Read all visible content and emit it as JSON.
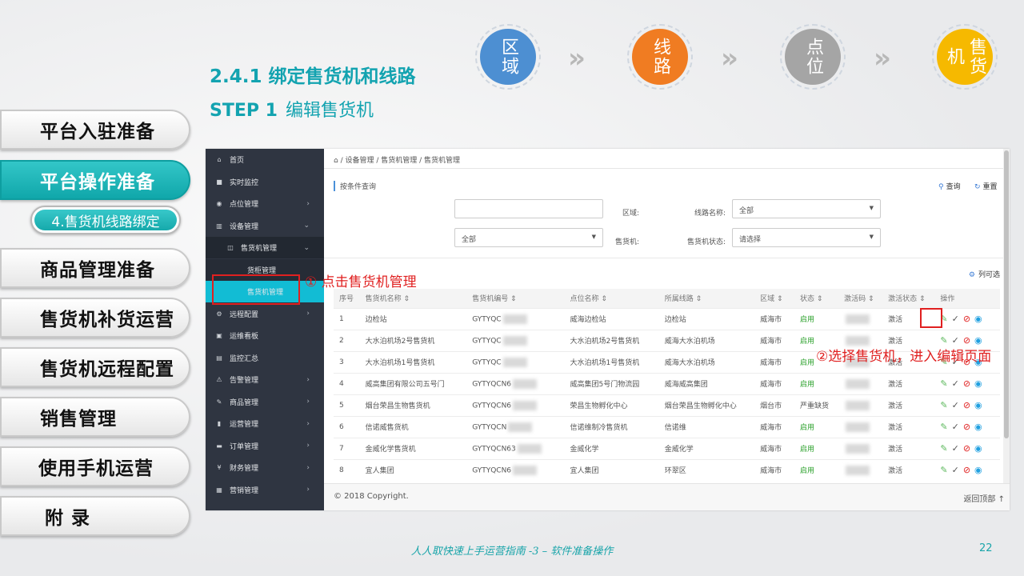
{
  "section_title": "2.4.1 绑定售货机和线路",
  "step_title": {
    "step": "STEP 1",
    "sub": "编辑售货机"
  },
  "steps": [
    {
      "label": "区域",
      "color": "#4d8fd2"
    },
    {
      "label": "线路",
      "color": "#f07c22"
    },
    {
      "label": "点位",
      "color": "#a5a5a5"
    },
    {
      "label": "售货机",
      "color": "#f6b900"
    }
  ],
  "chevron": "»",
  "left_nav": [
    "平台入驻准备",
    "平台操作准备",
    "商品管理准备",
    "售货机补货运营",
    "售货机远程配置",
    "销售管理",
    "使用手机运营",
    "附 录"
  ],
  "left_nav_active": "平台操作准备",
  "left_subtab": "4.售货机线路绑定",
  "app": {
    "sidebar": [
      {
        "icon": "home-icon",
        "glyph": "⌂",
        "label": "首页",
        "arrow": ""
      },
      {
        "icon": "camera-icon",
        "glyph": "■",
        "label": "实时监控",
        "arrow": ""
      },
      {
        "icon": "location-icon",
        "glyph": "◉",
        "label": "点位管理",
        "arrow": "›"
      },
      {
        "icon": "device-icon",
        "glyph": "▥",
        "label": "设备管理",
        "arrow": "⌄"
      },
      {
        "icon": "cabinet-icon",
        "glyph": "◫",
        "label": "售货机管理",
        "arrow": "⌄"
      },
      {
        "icon": "",
        "glyph": "",
        "label": "货柜管理",
        "arrow": ""
      },
      {
        "icon": "",
        "glyph": "",
        "label": "售货机管理",
        "arrow": ""
      },
      {
        "icon": "gears-icon",
        "glyph": "⚙",
        "label": "远程配置",
        "arrow": "›"
      },
      {
        "icon": "calendar-icon",
        "glyph": "▣",
        "label": "运维看板",
        "arrow": ""
      },
      {
        "icon": "file-icon",
        "glyph": "▤",
        "label": "监控汇总",
        "arrow": ""
      },
      {
        "icon": "alert-icon",
        "glyph": "⚠",
        "label": "告警管理",
        "arrow": "›"
      },
      {
        "icon": "edit-icon",
        "glyph": "✎",
        "label": "商品管理",
        "arrow": "›"
      },
      {
        "icon": "book-icon",
        "glyph": "▮",
        "label": "运营管理",
        "arrow": "›"
      },
      {
        "icon": "order-icon",
        "glyph": "▬",
        "label": "订单管理",
        "arrow": "›"
      },
      {
        "icon": "yen-icon",
        "glyph": "¥",
        "label": "财务管理",
        "arrow": "›"
      },
      {
        "icon": "marketing-icon",
        "glyph": "▦",
        "label": "营销管理",
        "arrow": "›"
      }
    ],
    "breadcrumb": "⌂ / 设备管理 / 售货机管理 / 售货机管理",
    "search_section": "按条件查询",
    "query_btn": "查询",
    "reset_btn": "重置",
    "filters": {
      "area_label": "区域:",
      "area_value": "",
      "route_label": "线路名称:",
      "route_value": "全部",
      "machine_label": "售货机:",
      "machine_value": "全部",
      "status_label": "售货机状态:",
      "status_value": "请选择"
    },
    "col_opt": "列可选",
    "headers": [
      "序号",
      "售货机名称 ⇕",
      "售货机编号 ⇕",
      "点位名称 ⇕",
      "所属线路 ⇕",
      "区域 ⇕",
      "状态 ⇕",
      "激活码 ⇕",
      "激活状态 ⇕",
      "操作"
    ],
    "rows": [
      [
        "1",
        "边检站",
        "GYTYQC",
        "威海边检站",
        "边检站",
        "威海市",
        "启用",
        "",
        "激活"
      ],
      [
        "2",
        "大水泊机场2号售货机",
        "GYTYQC",
        "大水泊机场2号售货机",
        "威海大水泊机场",
        "威海市",
        "启用",
        "",
        "激活"
      ],
      [
        "3",
        "大水泊机场1号售货机",
        "GYTYQC",
        "大水泊机场1号售货机",
        "威海大水泊机场",
        "威海市",
        "启用",
        "",
        "激活"
      ],
      [
        "4",
        "威高集团有限公司五号门",
        "GYTYQCN6",
        "威高集团5号门物流园",
        "威海威高集团",
        "威海市",
        "启用",
        "",
        "激活"
      ],
      [
        "5",
        "烟台荣昌生物售货机",
        "GYTYQCN6",
        "荣昌生物孵化中心",
        "烟台荣昌生物孵化中心",
        "烟台市",
        "严重缺货",
        "",
        "激活"
      ],
      [
        "6",
        "信诺威售货机",
        "GYTYQCN",
        "信诺维制冷售货机",
        "信诺维",
        "威海市",
        "启用",
        "",
        "激活"
      ],
      [
        "7",
        "金威化学售货机",
        "GYTYQCN63",
        "金威化学",
        "金威化学",
        "威海市",
        "启用",
        "",
        "激活"
      ],
      [
        "8",
        "宜人集团",
        "GYTYQCN6",
        "宜人集团",
        "环翠区",
        "威海市",
        "启用",
        "",
        "激活"
      ]
    ],
    "copyright": "© 2018 Copyright.",
    "back_top": "返回顶部 ↑"
  },
  "annotations": {
    "a1": "① 点击售货机管理",
    "a2": "②选择售货机，进入编辑页面"
  },
  "footer": "人人取快速上手运营指南 -3 – 软件准备操作",
  "page_number": "22",
  "colors": {
    "accent": "#13a3b0",
    "red": "#e02020",
    "sidebar_bg": "#2f3541",
    "selected": "#12bcd4"
  }
}
